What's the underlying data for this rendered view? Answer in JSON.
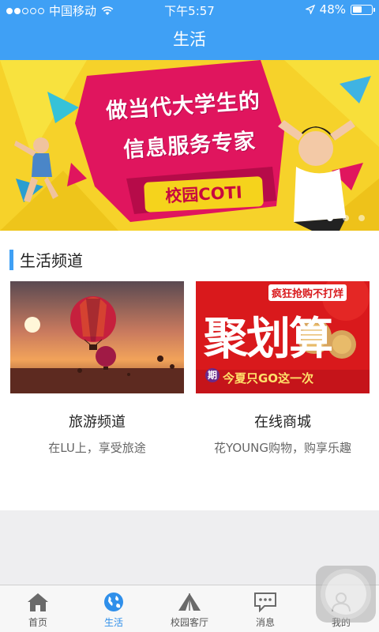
{
  "status_bar": {
    "carrier": "中国移动",
    "time": "下午5:57",
    "battery": "48%",
    "battery_level": 0.48
  },
  "header": {
    "title": "生活"
  },
  "banner": {
    "line1": "做当代大学生的",
    "line2": "信息服务专家",
    "pill": "校园COTI",
    "pages": 3,
    "active_page": 0
  },
  "section": {
    "title": "生活频道"
  },
  "cards": [
    {
      "title": "旅游频道",
      "subtitle": "在LU上，享受旅途"
    },
    {
      "title": "在线商城",
      "subtitle": "花YOUNG购物，购享乐趣",
      "image_text": {
        "tag": "疯狂抢购不打烊",
        "big": "聚划算",
        "bottom": "今夏只GO这一次",
        "badge": "期"
      }
    }
  ],
  "tabbar": {
    "items": [
      {
        "label": "首页",
        "icon": "home-icon"
      },
      {
        "label": "生活",
        "icon": "globe-icon",
        "active": true
      },
      {
        "label": "校园客厅",
        "icon": "tent-icon"
      },
      {
        "label": "消息",
        "icon": "chat-icon"
      },
      {
        "label": "我的",
        "icon": "user-icon"
      }
    ]
  },
  "colors": {
    "primary": "#3fa0f5",
    "banner_yellow": "#f5d31c",
    "banner_magenta": "#e0155e",
    "promo_red": "#e0161e"
  }
}
